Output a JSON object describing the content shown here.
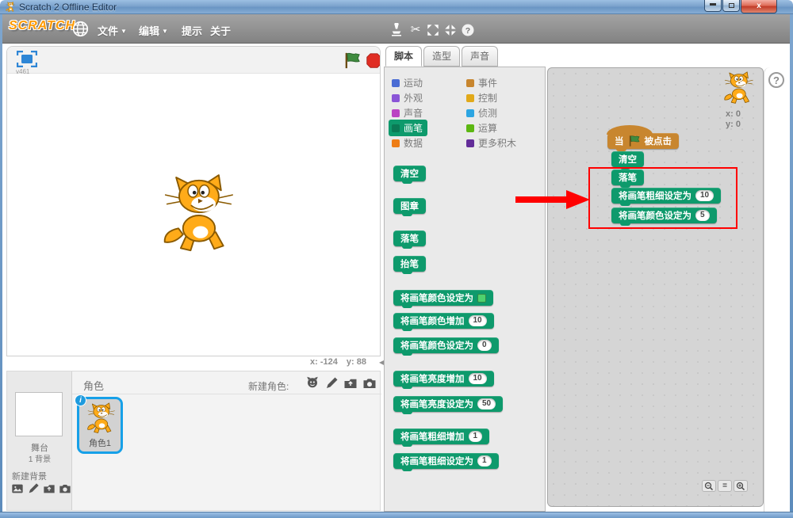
{
  "colors": {
    "pen": "#0e9a6c",
    "events": "#c8862f",
    "pen_swatch": "#4fd16e",
    "motion": "#4a6cd4",
    "looks": "#8a55d7",
    "sound": "#bb42c3",
    "data": "#ee7d16",
    "control": "#e1a91a",
    "sensing": "#2ca5e2",
    "operators": "#5cb712",
    "more_blocks": "#632d99",
    "selection_blue": "#16a0e8",
    "annotation_red": "#ff0000"
  },
  "titlebar": {
    "title": "Scratch 2 Offline Editor",
    "close_glyph": "x"
  },
  "menubar": {
    "logo": "SCRATCH",
    "file": "文件",
    "edit": "编辑",
    "tips": "提示",
    "about": "关于",
    "caret": "▼"
  },
  "stage": {
    "version": "v461",
    "x_text": "x: -124",
    "y_text": "y: 88",
    "collapse_glyph": "◀"
  },
  "sprites": {
    "header": "角色",
    "new_sprite_label": "新建角色:",
    "stage_name": "舞台",
    "stage_sub": "1 背景",
    "new_backdrop_label": "新建背景",
    "sprite_name": "角色1",
    "info_badge": "i"
  },
  "palette": {
    "tabs": [
      {
        "label": "脚本"
      },
      {
        "label": "造型"
      },
      {
        "label": "声音"
      }
    ],
    "categories": [
      {
        "label": "运动",
        "color": "#4a6cd4"
      },
      {
        "label": "外观",
        "color": "#8a55d7"
      },
      {
        "label": "声音",
        "color": "#bb42c3"
      },
      {
        "label": "画笔",
        "color": "#0e9a6c",
        "selected": true
      },
      {
        "label": "数据",
        "color": "#ee7d16"
      },
      {
        "label": "事件",
        "color": "#c8862f"
      },
      {
        "label": "控制",
        "color": "#e1a91a"
      },
      {
        "label": "侦测",
        "color": "#2ca5e2"
      },
      {
        "label": "运算",
        "color": "#5cb712"
      },
      {
        "label": "更多积木",
        "color": "#632d99"
      }
    ],
    "blocks": [
      {
        "label": "清空"
      },
      {
        "label": "图章"
      },
      {
        "label": "落笔"
      },
      {
        "label": "抬笔"
      },
      {
        "label": "将画笔颜色设定为"
      },
      {
        "label": "将画笔颜色增加",
        "value": "10"
      },
      {
        "label": "将画笔颜色设定为",
        "value": "0"
      },
      {
        "label": "将画笔亮度增加",
        "value": "10"
      },
      {
        "label": "将画笔亮度设定为",
        "value": "50"
      },
      {
        "label": "将画笔粗细增加",
        "value": "1"
      },
      {
        "label": "将画笔粗细设定为",
        "value": "1"
      }
    ]
  },
  "script": {
    "sprite_x": "x: 0",
    "sprite_y": "y: 0",
    "hat_prefix": "当",
    "hat_suffix": "被点击",
    "blocks": [
      {
        "label": "清空"
      },
      {
        "label": "落笔"
      },
      {
        "label": "将画笔粗细设定为",
        "value": "10"
      },
      {
        "label": "将画笔颜色设定为",
        "value": "5"
      }
    ],
    "zoom_reset": "="
  }
}
